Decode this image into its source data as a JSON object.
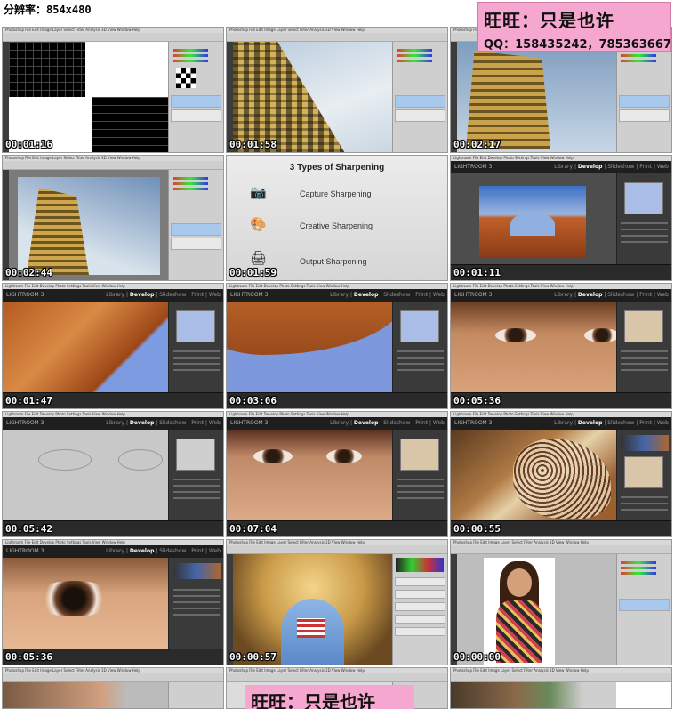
{
  "resolution_label": "分辨率：854x480",
  "contact": {
    "line1": "旺旺：只是也许",
    "line2": "QQ：158435242，785363667"
  },
  "contact_bottom": {
    "line1": "旺旺：只是也许"
  },
  "menu_ps": "Photoshop  File  Edit  Image  Layer  Select  Filter  Analysis  3D  View  Window  Help",
  "menu_lr": "Lightroom  File  Edit  Develop  Photo  Settings  Tools  View  Window  Help",
  "lightroom": {
    "logo": "LIGHTROOM 3",
    "modules": [
      "Library",
      "Develop",
      "Slideshow",
      "Print",
      "Web"
    ]
  },
  "sharpening_slide": {
    "title": "3 Types of Sharpening",
    "items": [
      {
        "icon": "camera-icon",
        "label": "Capture Sharpening"
      },
      {
        "icon": "palette-icon",
        "label": "Creative Sharpening"
      },
      {
        "icon": "printer-icon",
        "label": "Output Sharpening"
      }
    ]
  },
  "thumbnails": [
    {
      "timecode": "00:01:16",
      "app": "photoshop",
      "scene": "checkerboard"
    },
    {
      "timecode": "00:01:58",
      "app": "photoshop",
      "scene": "building-pixelated"
    },
    {
      "timecode": "00:02:17",
      "app": "photoshop",
      "scene": "building-sky"
    },
    {
      "timecode": "00:02:44",
      "app": "photoshop",
      "scene": "building-sky"
    },
    {
      "timecode": "00:01:59",
      "app": "slide",
      "scene": "sharpening-types"
    },
    {
      "timecode": "00:01:11",
      "app": "lightroom",
      "scene": "rock-arch"
    },
    {
      "timecode": "00:01:47",
      "app": "lightroom",
      "scene": "rock-closeup"
    },
    {
      "timecode": "00:03:06",
      "app": "lightroom",
      "scene": "arch-sky"
    },
    {
      "timecode": "00:05:36",
      "app": "lightroom",
      "scene": "eyes"
    },
    {
      "timecode": "00:05:42",
      "app": "lightroom",
      "scene": "eyes-mask"
    },
    {
      "timecode": "00:07:04",
      "app": "lightroom",
      "scene": "eyes"
    },
    {
      "timecode": "00:00:55",
      "app": "lightroom",
      "scene": "fabric"
    },
    {
      "timecode": "00:05:36",
      "app": "lightroom",
      "scene": "eye-closeup"
    },
    {
      "timecode": "00:00:57",
      "app": "photoshop",
      "scene": "dome"
    },
    {
      "timecode": "00:00:00",
      "app": "photoshop",
      "scene": "portrait"
    }
  ],
  "colors": {
    "contact_bg": "#f5a7cf",
    "lr_dark": "#1e1e1e",
    "ps_panel": "#cfcfcf"
  }
}
